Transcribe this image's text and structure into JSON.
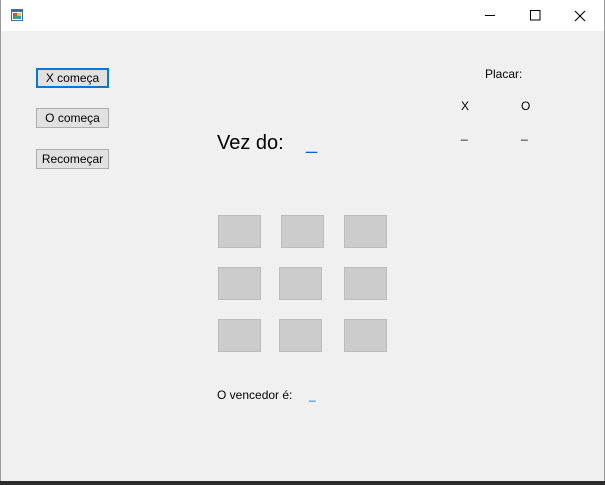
{
  "window": {
    "title": ""
  },
  "buttons": {
    "x_starts": "X começa",
    "o_starts": "O começa",
    "restart": "Recomeçar"
  },
  "turn": {
    "label": "Vez do:",
    "value": "_"
  },
  "score": {
    "title": "Placar:",
    "x_label": "X",
    "o_label": "O",
    "x_value": "_",
    "o_value": "_"
  },
  "winner": {
    "label": "O vencedor é:",
    "value": "_"
  },
  "board": {
    "cells": [
      "",
      "",
      "",
      "",
      "",
      "",
      "",
      "",
      ""
    ]
  },
  "colors": {
    "accent": "#0078d7",
    "cell_fill": "#cccccc",
    "form_background": "#f0f0f0",
    "value_text": "#0066cc"
  },
  "icons": {
    "app": "windows-form-icon",
    "minimize": "minimize-icon",
    "maximize": "maximize-icon",
    "close": "close-icon"
  }
}
